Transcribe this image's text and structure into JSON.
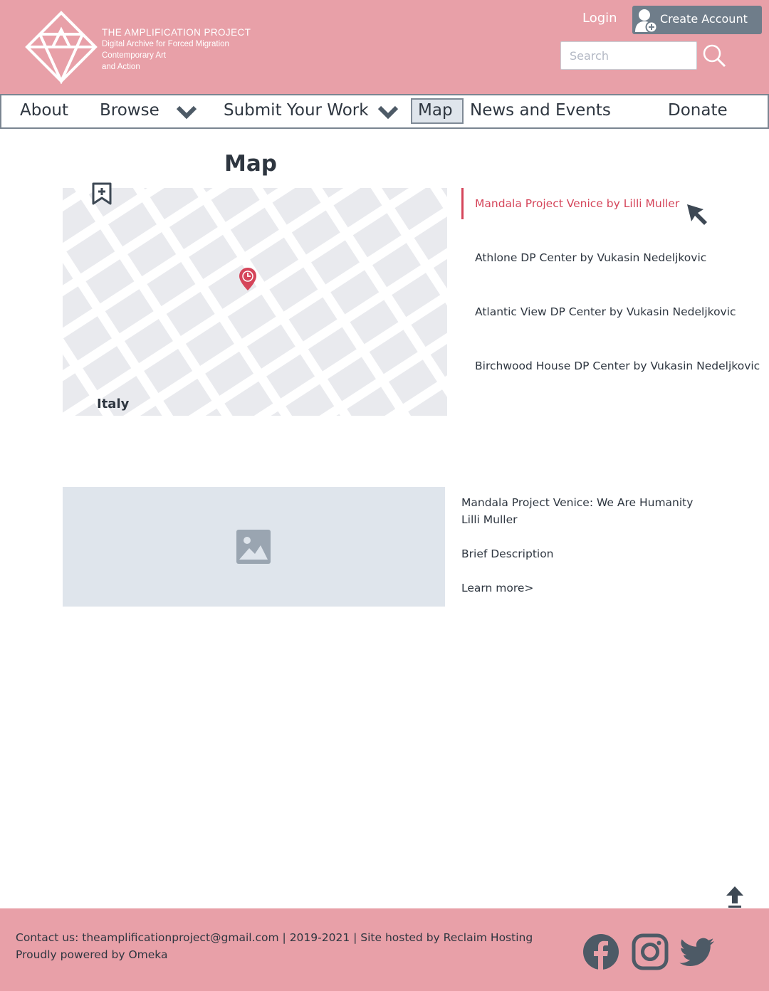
{
  "header": {
    "brand_title": "THE AMPLIFICATION PROJECT",
    "brand_lines": [
      "Digital Archive for Forced Migration",
      "Contemporary Art",
      "and Action"
    ],
    "login_label": "Login",
    "create_account_label": "Create Account",
    "search_placeholder": "Search"
  },
  "nav": {
    "items": [
      {
        "label": "About",
        "has_dropdown": false
      },
      {
        "label": "Browse",
        "has_dropdown": true
      },
      {
        "label": "Submit Your Work",
        "has_dropdown": true
      },
      {
        "label": "Map",
        "has_dropdown": false,
        "selected": true
      },
      {
        "label": "News and Events",
        "has_dropdown": false
      },
      {
        "label": "Donate",
        "has_dropdown": false
      }
    ]
  },
  "main": {
    "title": "Map",
    "map_region_label": "Italy",
    "locations": [
      {
        "label": "Mandala Project Venice by Lilli Muller",
        "active": true
      },
      {
        "label": "Athlone DP Center by Vukasin Nedeljkovic",
        "active": false
      },
      {
        "label": "Atlantic View DP Center by Vukasin Nedeljkovic",
        "active": false
      },
      {
        "label": "Birchwood House DP Center by Vukasin Nedeljkovic",
        "active": false
      }
    ],
    "detail": {
      "title": "Mandala Project Venice: We Are Humanity",
      "artist": "Lilli Muller",
      "description": "Brief Description",
      "learn_more": "Learn more>"
    }
  },
  "footer": {
    "line1": "Contact us: theamplificationproject@gmail.com | 2019-2021 | Site hosted by Reclaim Hosting",
    "line2": "Proudly powered by Omeka",
    "social": [
      "facebook-icon",
      "instagram-icon",
      "twitter-icon"
    ]
  },
  "colors": {
    "brand_pink": "#e8a0a8",
    "accent_red": "#d5455a",
    "text_dark": "#2e3640",
    "button_gray": "#6f7d8a",
    "placeholder_bg": "#dfe5ec"
  }
}
